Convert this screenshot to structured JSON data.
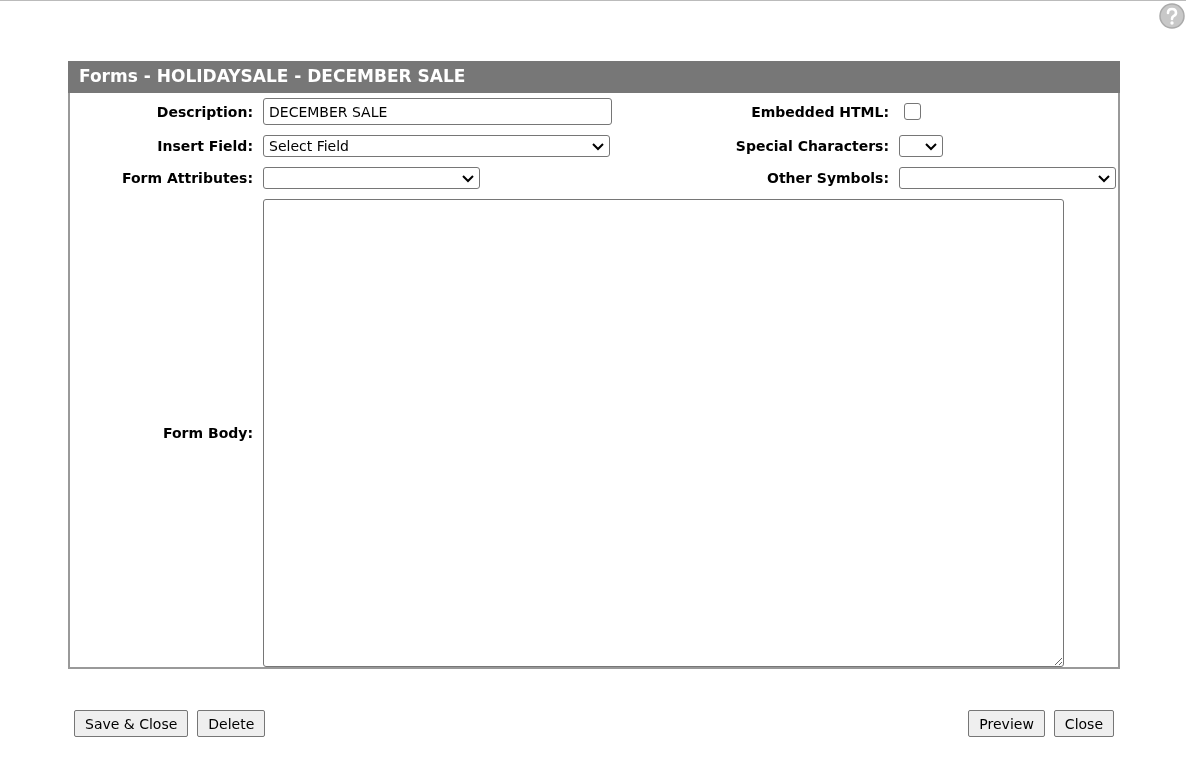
{
  "panel": {
    "title": "Forms - HOLIDAYSALE - DECEMBER SALE"
  },
  "fields": [
    {
      "kind": "text",
      "label": "Description:",
      "value": "DECEMBER SALE"
    },
    {
      "kind": "checkbox",
      "label": "Embedded HTML:",
      "checked": false
    },
    {
      "kind": "select",
      "label": "Insert Field:",
      "value": "Select Field"
    },
    {
      "kind": "select",
      "label": "Special Characters:"
    },
    {
      "kind": "select",
      "label": "Form Attributes:"
    },
    {
      "kind": "select",
      "label": "Other Symbols:"
    },
    {
      "kind": "textarea",
      "label": "Form Body:"
    }
  ],
  "buttons_left": [
    "Save & Close",
    "Delete"
  ],
  "buttons_right": [
    "Preview",
    "Close"
  ]
}
